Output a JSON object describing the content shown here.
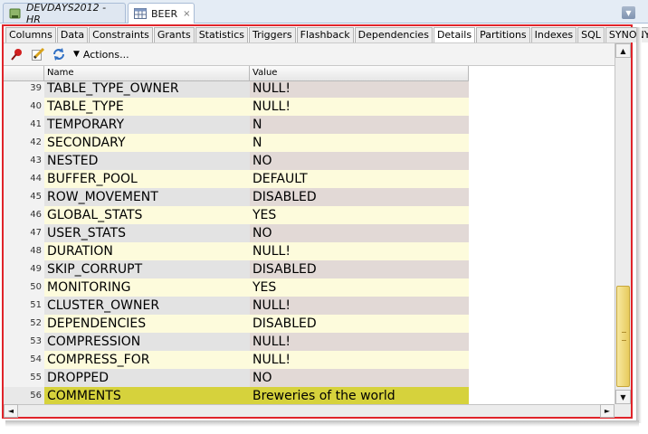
{
  "editor_tabs": [
    {
      "label": "DEVDAYS2012 - HR",
      "icon": "database-connection-icon"
    },
    {
      "label": "BEER",
      "icon": "table-icon",
      "close": "×"
    }
  ],
  "dropdown_glyph": "▼",
  "sub_tabs": [
    "Columns",
    "Data",
    "Constraints",
    "Grants",
    "Statistics",
    "Triggers",
    "Flashback",
    "Dependencies",
    "Details",
    "Partitions",
    "Indexes",
    "SQL",
    "SYNONYMS"
  ],
  "active_sub_tab": "Details",
  "toolbar": {
    "actions_label": "Actions...",
    "buttons": [
      "pin-icon",
      "edit-icon",
      "refresh-icon"
    ]
  },
  "grid": {
    "columns": {
      "name": "Name",
      "value": "Value"
    },
    "rows": [
      {
        "num": "39",
        "name": "TABLE_TYPE_OWNER",
        "value": "NULL!"
      },
      {
        "num": "40",
        "name": "TABLE_TYPE",
        "value": "NULL!"
      },
      {
        "num": "41",
        "name": "TEMPORARY",
        "value": "N"
      },
      {
        "num": "42",
        "name": "SECONDARY",
        "value": "N"
      },
      {
        "num": "43",
        "name": "NESTED",
        "value": "NO"
      },
      {
        "num": "44",
        "name": "BUFFER_POOL",
        "value": "DEFAULT"
      },
      {
        "num": "45",
        "name": "ROW_MOVEMENT",
        "value": "DISABLED"
      },
      {
        "num": "46",
        "name": "GLOBAL_STATS",
        "value": "YES"
      },
      {
        "num": "47",
        "name": "USER_STATS",
        "value": "NO"
      },
      {
        "num": "48",
        "name": "DURATION",
        "value": "NULL!"
      },
      {
        "num": "49",
        "name": "SKIP_CORRUPT",
        "value": "DISABLED"
      },
      {
        "num": "50",
        "name": "MONITORING",
        "value": "YES"
      },
      {
        "num": "51",
        "name": "CLUSTER_OWNER",
        "value": "NULL!"
      },
      {
        "num": "52",
        "name": "DEPENDENCIES",
        "value": "DISABLED"
      },
      {
        "num": "53",
        "name": "COMPRESSION",
        "value": "NULL!"
      },
      {
        "num": "54",
        "name": "COMPRESS_FOR",
        "value": "NULL!"
      },
      {
        "num": "55",
        "name": "DROPPED",
        "value": "NO"
      },
      {
        "num": "56",
        "name": "COMMENTS",
        "value": "Breweries of the world"
      }
    ],
    "selected_row": "56"
  },
  "scrollbar": {
    "up": "▲",
    "down": "▼",
    "left": "◄",
    "right": "►"
  },
  "colors": {
    "highlight_border": "#e0242a",
    "selected_row": "#d6d23c",
    "row_light": "#fdfbdc",
    "row_dark": "#e2d9d6"
  }
}
